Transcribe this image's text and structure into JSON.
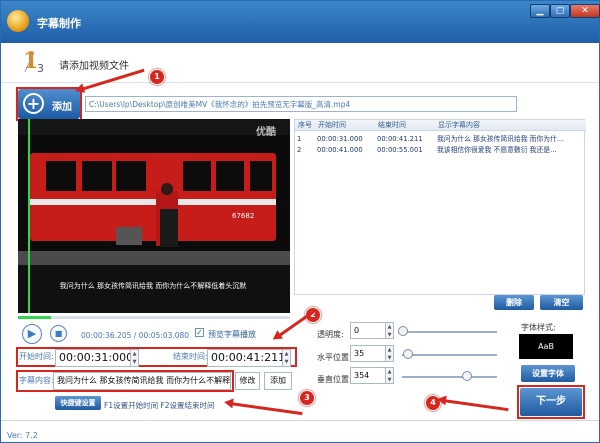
{
  "window": {
    "title": "字幕制作",
    "min": "▁",
    "max": "▢",
    "close": "✕"
  },
  "step": {
    "number": "1",
    "total": "3",
    "text": "请添加视频文件"
  },
  "markers": [
    "1",
    "2",
    "3",
    "4"
  ],
  "add": {
    "label": "添加"
  },
  "file_path": "C:\\Users\\lp\\Desktop\\原创唯美MV《我怀念的》拍先预览无字幕版_高清.mp4",
  "video": {
    "watermark": "优酷",
    "subtitle": "我问为什么 那女孩传简讯给我 而你为什么不解释低着头沉默"
  },
  "table": {
    "headers": [
      "序号",
      "开始时间",
      "结束时间",
      "显示字幕内容"
    ],
    "rows": [
      [
        "1",
        "00:00:31.000",
        "00:00:41.211",
        "我问为什么 那女孩传简讯给我 而你为什..."
      ],
      [
        "2",
        "00:00:41.000",
        "00:00:55.001",
        "我该相信你很爱我 不愿意敷衍 我还是..."
      ]
    ]
  },
  "buttons": {
    "delete": "删除",
    "clear": "清空",
    "edit": "修改",
    "add_sub": "添加",
    "shortcut": "快捷键设置",
    "font": "设置字体",
    "next": "下一步"
  },
  "player": {
    "time": "00:00:36.205 / 00:05:03.080",
    "preview_label": "预览字幕播放",
    "progress": 0.12
  },
  "inputs": {
    "start_label": "开始时间:",
    "start_time": "00:00:31:000",
    "end_label": "结束时间:",
    "end_time": "00:00:41:211",
    "content_label": "字幕内容:",
    "content": "我问为什么 那女孩传简讯给我 而你为什么不解释低"
  },
  "shortcut_hint": "F1设置开始时间 F2设置结束时间",
  "style": {
    "transparency_label": "透明度:",
    "transparency": "0",
    "h_label": "水平位置:",
    "h_value": "35",
    "v_label": "垂直位置:",
    "v_value": "354",
    "font_style_label": "字体样式:",
    "preview_text": "AaB"
  },
  "status": "Ver: 7.2"
}
